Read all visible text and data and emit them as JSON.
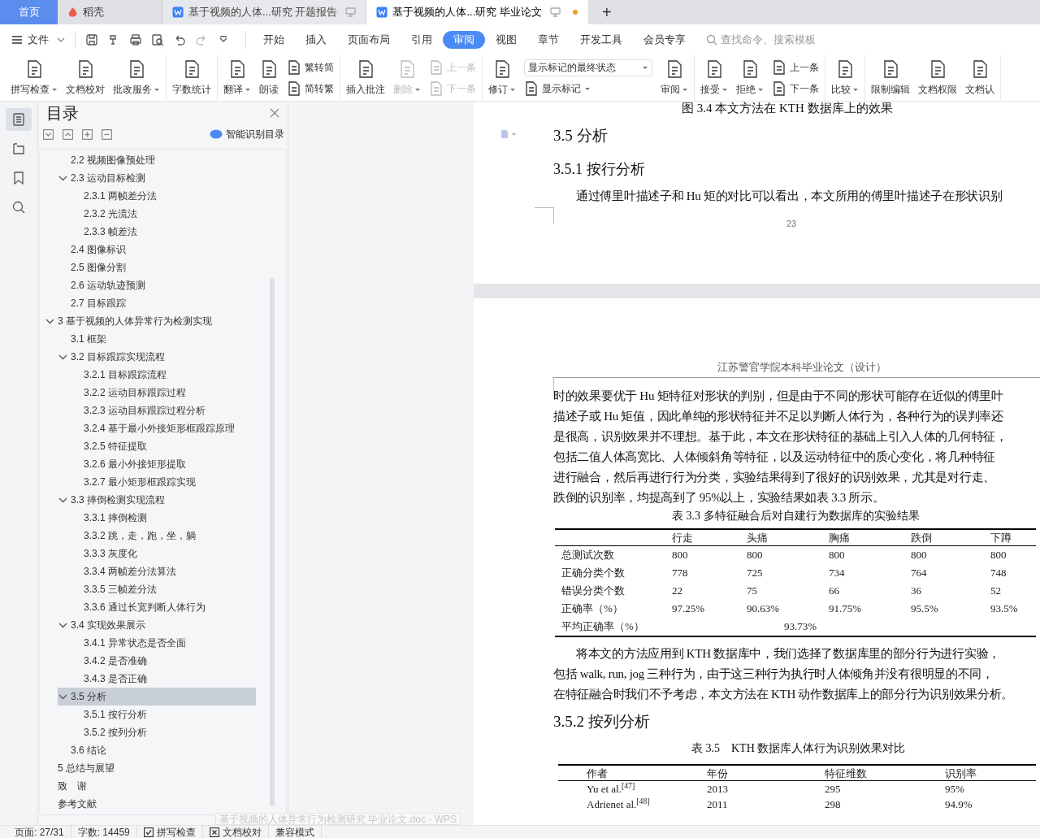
{
  "title_tabs": [
    {
      "kind": "home",
      "label": "首页",
      "selected": false
    },
    {
      "kind": "app",
      "label": "稻壳",
      "selected": false
    },
    {
      "kind": "doc",
      "label": "基于视频的人体...研究 开题报告",
      "selected": false,
      "modified": false
    },
    {
      "kind": "doc",
      "label": "基于视频的人体...研究 毕业论文",
      "selected": true,
      "modified": true
    }
  ],
  "new_tab": "+",
  "menu": {
    "file": "文件",
    "tabs": [
      {
        "label": "开始",
        "selected": false
      },
      {
        "label": "插入",
        "selected": false
      },
      {
        "label": "页面布局",
        "selected": false
      },
      {
        "label": "引用",
        "selected": false
      },
      {
        "label": "审阅",
        "selected": true
      },
      {
        "label": "视图",
        "selected": false
      },
      {
        "label": "章节",
        "selected": false
      },
      {
        "label": "开发工具",
        "selected": false
      },
      {
        "label": "会员专享",
        "selected": false
      }
    ],
    "search": {
      "placeholder": "查找命令、搜索模板"
    }
  },
  "ribbon": [
    {
      "items": [
        {
          "kind": "large",
          "label": "拼写检查",
          "dropdown": true,
          "disabled": false
        },
        {
          "kind": "large",
          "label": "文档校对",
          "dropdown": false,
          "disabled": false
        },
        {
          "kind": "large",
          "label": "批改服务",
          "dropdown": true,
          "disabled": false
        }
      ]
    },
    {
      "items": [
        {
          "kind": "large",
          "label": "字数统计",
          "dropdown": false,
          "disabled": false
        }
      ]
    },
    {
      "items": [
        {
          "kind": "large",
          "label": "翻译",
          "dropdown": true,
          "disabled": false
        },
        {
          "kind": "large",
          "label": "朗读",
          "dropdown": false,
          "disabled": false
        },
        {
          "kind": "stack",
          "items": [
            {
              "kind": "small",
              "label": "繁转简",
              "dropdown": false,
              "disabled": false
            },
            {
              "kind": "small",
              "label": "简转繁",
              "dropdown": false,
              "disabled": false
            }
          ]
        }
      ]
    },
    {
      "items": [
        {
          "kind": "large",
          "label": "插入批注",
          "dropdown": false,
          "disabled": false
        },
        {
          "kind": "large",
          "label": "删除",
          "dropdown": true,
          "disabled": true
        },
        {
          "kind": "stack",
          "items": [
            {
              "kind": "small",
              "label": "上一条",
              "dropdown": false,
              "disabled": true
            },
            {
              "kind": "small",
              "label": "下一条",
              "dropdown": false,
              "disabled": true
            }
          ]
        }
      ]
    },
    {
      "items": [
        {
          "kind": "large",
          "label": "修订",
          "dropdown": true,
          "disabled": false
        },
        {
          "kind": "stack",
          "items": [
            {
              "kind": "select",
              "label": "显示标记的最终状态",
              "dropdown": true,
              "disabled": false
            },
            {
              "kind": "small",
              "label": "显示标记",
              "dropdown": true,
              "disabled": false
            }
          ]
        },
        {
          "kind": "large",
          "label": "审阅",
          "dropdown": true,
          "disabled": false
        }
      ]
    },
    {
      "items": [
        {
          "kind": "large",
          "label": "接受",
          "dropdown": true,
          "disabled": false
        },
        {
          "kind": "large",
          "label": "拒绝",
          "dropdown": true,
          "disabled": false
        },
        {
          "kind": "stack",
          "items": [
            {
              "kind": "small",
              "label": "上一条",
              "dropdown": false,
              "disabled": false
            },
            {
              "kind": "small",
              "label": "下一条",
              "dropdown": false,
              "disabled": false
            }
          ]
        }
      ]
    },
    {
      "items": [
        {
          "kind": "large",
          "label": "比较",
          "dropdown": true,
          "disabled": false
        }
      ]
    },
    {
      "items": [
        {
          "kind": "large",
          "label": "限制编辑",
          "dropdown": false,
          "disabled": false
        },
        {
          "kind": "large",
          "label": "文档权限",
          "dropdown": false,
          "disabled": false
        },
        {
          "kind": "large",
          "label": "文档认",
          "dropdown": false,
          "disabled": false
        }
      ]
    }
  ],
  "side_tools": [
    {
      "kind": "toc",
      "selected": true
    },
    {
      "kind": "outline",
      "selected": false
    },
    {
      "kind": "bookmark",
      "selected": false
    },
    {
      "kind": "search",
      "selected": false
    }
  ],
  "toc": {
    "title": "目录",
    "smart_button": "智能识别目录",
    "partial_children": [
      {
        "label": "2.2  视频图像预处理",
        "selected": false
      },
      {
        "label": "2.3  运动目标检测",
        "selected": false,
        "expanded": true,
        "children": [
          {
            "label": "2.3.1  两帧差分法",
            "selected": false
          },
          {
            "label": "2.3.2  光流法",
            "selected": false
          },
          {
            "label": "2.3.3  帧差法",
            "selected": false
          }
        ]
      },
      {
        "label": "2.4  图像标识",
        "selected": false
      },
      {
        "label": "2.5  图像分割",
        "selected": false
      },
      {
        "label": "2.6  运动轨迹预测",
        "selected": false
      },
      {
        "label": "2.7  目标跟踪",
        "selected": false
      }
    ],
    "items": [
      {
        "label": "3  基于视频的人体异常行为检测实现",
        "selected": false,
        "expanded": true,
        "children": [
          {
            "label": "3.1  框架",
            "selected": false
          },
          {
            "label": "3.2  目标跟踪实现流程",
            "selected": false,
            "expanded": true,
            "children": [
              {
                "label": "3.2.1 目标跟踪流程",
                "selected": false
              },
              {
                "label": "3.2.2  运动目标跟踪过程",
                "selected": false
              },
              {
                "label": "3.2.3  运动目标跟踪过程分析",
                "selected": false
              },
              {
                "label": "3.2.4 基于最小外接矩形框跟踪原理",
                "selected": false
              },
              {
                "label": "3.2.5 特征提取",
                "selected": false
              },
              {
                "label": "3.2.6  最小外接矩形提取",
                "selected": false
              },
              {
                "label": "3.2.7 最小矩形框跟踪实现",
                "selected": false
              }
            ]
          },
          {
            "label": "3.3  摔倒检测实现流程",
            "selected": false,
            "expanded": true,
            "children": [
              {
                "label": "3.3.1 摔倒检测",
                "selected": false
              },
              {
                "label": "3.3.2  跳，走，跑，坐，躺",
                "selected": false
              },
              {
                "label": "3.3.3  灰度化",
                "selected": false
              },
              {
                "label": "3.3.4  两帧差分法算法",
                "selected": false
              },
              {
                "label": "3.3.5  三帧差分法",
                "selected": false
              },
              {
                "label": "3.3.6  通过长宽判断人体行为",
                "selected": false
              }
            ]
          },
          {
            "label": "3.4 实现效果展示",
            "selected": false,
            "expanded": true,
            "children": [
              {
                "label": "3.4.1 异常状态是否全面",
                "selected": false
              },
              {
                "label": "3.4.2  是否准确",
                "selected": false
              },
              {
                "label": "3.4.3 是否正确",
                "selected": false
              }
            ]
          },
          {
            "label": "3.5  分析",
            "selected": true,
            "expanded": true,
            "children": [
              {
                "label": "3.5.1  按行分析",
                "selected": false
              },
              {
                "label": "3.5.2  按列分析",
                "selected": false
              }
            ]
          },
          {
            "label": "3.6 结论",
            "selected": false
          }
        ]
      },
      {
        "label": "5  总结与展望",
        "selected": false
      },
      {
        "label": "致　谢",
        "selected": false
      },
      {
        "label": "参考文献",
        "selected": false
      }
    ]
  },
  "page1": {
    "cut_caption": "图 3.4 本文方法在 KTH 数据库上的效果",
    "heading": "3.5  分析",
    "subheading": "3.5.1  按行分析",
    "paragraph": {
      "continued": false,
      "lines": [
        "通过傅里叶描述子和 Hu 矩的对比可以看出，本文所用的傅里叶描述子在形状识别"
      ]
    },
    "page_number": "23"
  },
  "page2": {
    "header": "江苏警官学院本科毕业论文（设计）",
    "paragraph1": {
      "continued": true,
      "lines": [
        "时的效果要优于 Hu 矩特征对形状的判别，但是由于不同的形状可能存在近似的傅里叶",
        "描述子或 Hu 矩值，因此单纯的形状特征并不足以判断人体行为，各种行为的误判率还",
        "是很高，识别效果并不理想。基于此，本文在形状特征的基础上引入人体的几何特征，",
        "包括二值人体高宽比、人体倾斜角等特征，以及运动特征中的质心变化，将几种特征",
        "进行融合，然后再进行行为分类，实验结果得到了很好的识别效果，尤其是对行走、",
        "跌倒的识别率，均提高到了 95%以上，实验结果如表 3.3 所示。"
      ]
    },
    "table1": {
      "caption": "表 3.3 多特征融合后对自建行为数据库的实验结果",
      "columns": [
        "",
        "行走",
        "头痛",
        "胸痛",
        "跌倒",
        "下蹲"
      ],
      "rows": [
        [
          "总测试次数",
          "800",
          "800",
          "800",
          "800",
          "800"
        ],
        [
          "正确分类个数",
          "778",
          "725",
          "734",
          "764",
          "748"
        ],
        [
          "错误分类个数",
          "22",
          "75",
          "66",
          "36",
          "52"
        ],
        [
          "正确率（%）",
          "97.25%",
          "90.63%",
          "91.75%",
          "95.5%",
          "93.5%"
        ]
      ],
      "summary": {
        "label": "平均正确率（%）",
        "value": "93.73%"
      }
    },
    "paragraph2": {
      "continued": false,
      "lines": [
        "将本文的方法应用到 KTH 数据库中，我们选择了数据库里的部分行为进行实验，",
        "包括 walk, run, jog 三种行为，由于这三种行为执行时人体倾角并没有很明显的不同，",
        "在特征融合时我们不予考虑，本文方法在 KTH 动作数据库上的部分行为识别效果分析。"
      ]
    },
    "heading": "3.5.2  按列分析",
    "table2": {
      "caption": "表 3.5　KTH 数据库人体行为识别效果对比",
      "columns": [
        "作者",
        "年份",
        "特征维数",
        "识别率"
      ],
      "rows": [
        [
          "Yu et al.$^{[47]}$",
          "2013",
          "295",
          "95%"
        ],
        [
          "Adrienet al.$^{[48]}$",
          "2011",
          "298",
          "94.9%"
        ]
      ]
    }
  },
  "tooltip": "基于视频的人体异常行为检测研究 毕业论文.doc - WPS",
  "status_bar": [
    {
      "kind": "text",
      "label": "页面: 27/31"
    },
    {
      "kind": "text",
      "label": "字数: 14459"
    },
    {
      "kind": "check",
      "label": "拼写检查",
      "checked": true
    },
    {
      "kind": "check",
      "label": "文档校对",
      "checked": false
    },
    {
      "kind": "text",
      "label": "兼容模式"
    }
  ]
}
